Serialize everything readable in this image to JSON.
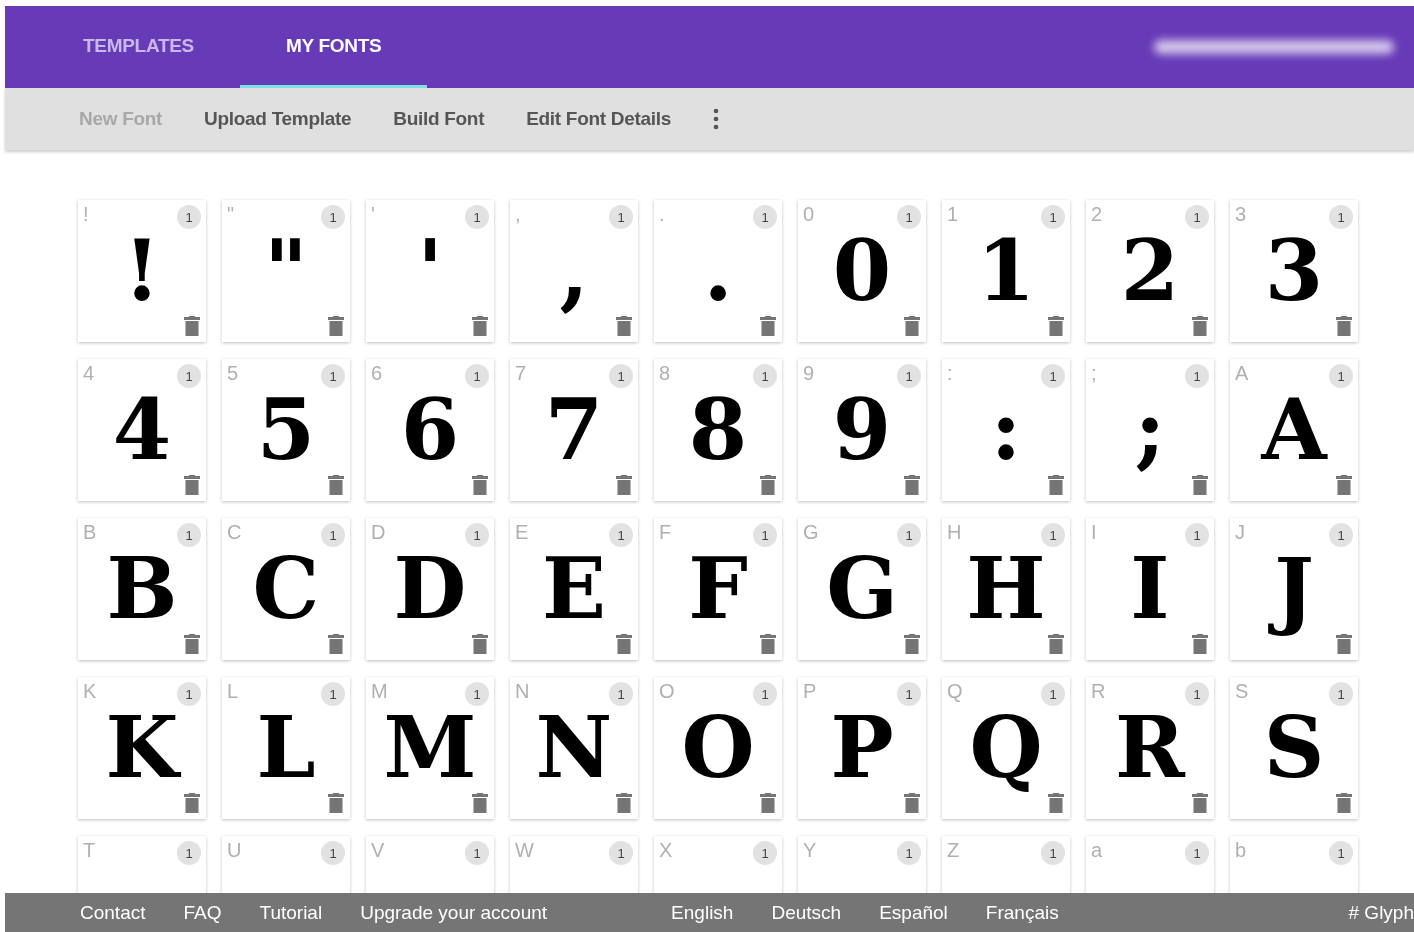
{
  "header": {
    "tabs": [
      {
        "label": "TEMPLATES",
        "selected": false
      },
      {
        "label": "MY FONTS",
        "selected": true
      }
    ]
  },
  "toolbar": {
    "actions": [
      {
        "label": "New Font",
        "disabled": true
      },
      {
        "label": "Upload Template",
        "disabled": false
      },
      {
        "label": "Build Font",
        "disabled": false
      },
      {
        "label": "Edit Font Details",
        "disabled": false
      }
    ]
  },
  "glyphs": [
    {
      "label": "!",
      "count": "1",
      "glyph": "!"
    },
    {
      "label": "\"",
      "count": "1",
      "glyph": "\""
    },
    {
      "label": "'",
      "count": "1",
      "glyph": "'"
    },
    {
      "label": ",",
      "count": "1",
      "glyph": ","
    },
    {
      "label": ".",
      "count": "1",
      "glyph": "."
    },
    {
      "label": "0",
      "count": "1",
      "glyph": "0"
    },
    {
      "label": "1",
      "count": "1",
      "glyph": "1"
    },
    {
      "label": "2",
      "count": "1",
      "glyph": "2"
    },
    {
      "label": "3",
      "count": "1",
      "glyph": "3"
    },
    {
      "label": "4",
      "count": "1",
      "glyph": "4"
    },
    {
      "label": "5",
      "count": "1",
      "glyph": "5"
    },
    {
      "label": "6",
      "count": "1",
      "glyph": "6"
    },
    {
      "label": "7",
      "count": "1",
      "glyph": "7"
    },
    {
      "label": "8",
      "count": "1",
      "glyph": "8"
    },
    {
      "label": "9",
      "count": "1",
      "glyph": "9"
    },
    {
      "label": ":",
      "count": "1",
      "glyph": ":"
    },
    {
      "label": ";",
      "count": "1",
      "glyph": ";"
    },
    {
      "label": "A",
      "count": "1",
      "glyph": "A"
    },
    {
      "label": "B",
      "count": "1",
      "glyph": "B"
    },
    {
      "label": "C",
      "count": "1",
      "glyph": "C"
    },
    {
      "label": "D",
      "count": "1",
      "glyph": "D"
    },
    {
      "label": "E",
      "count": "1",
      "glyph": "E"
    },
    {
      "label": "F",
      "count": "1",
      "glyph": "F"
    },
    {
      "label": "G",
      "count": "1",
      "glyph": "G"
    },
    {
      "label": "H",
      "count": "1",
      "glyph": "H"
    },
    {
      "label": "I",
      "count": "1",
      "glyph": "I"
    },
    {
      "label": "J",
      "count": "1",
      "glyph": "J"
    },
    {
      "label": "K",
      "count": "1",
      "glyph": "K"
    },
    {
      "label": "L",
      "count": "1",
      "glyph": "L"
    },
    {
      "label": "M",
      "count": "1",
      "glyph": "M"
    },
    {
      "label": "N",
      "count": "1",
      "glyph": "N"
    },
    {
      "label": "O",
      "count": "1",
      "glyph": "O"
    },
    {
      "label": "P",
      "count": "1",
      "glyph": "P"
    },
    {
      "label": "Q",
      "count": "1",
      "glyph": "Q"
    },
    {
      "label": "R",
      "count": "1",
      "glyph": "R"
    },
    {
      "label": "S",
      "count": "1",
      "glyph": "S"
    },
    {
      "label": "T",
      "count": "1"
    },
    {
      "label": "U",
      "count": "1"
    },
    {
      "label": "V",
      "count": "1"
    },
    {
      "label": "W",
      "count": "1"
    },
    {
      "label": "X",
      "count": "1"
    },
    {
      "label": "Y",
      "count": "1"
    },
    {
      "label": "Z",
      "count": "1"
    },
    {
      "label": "a",
      "count": "1"
    },
    {
      "label": "b",
      "count": "1"
    }
  ],
  "footer": {
    "links": [
      "Contact",
      "FAQ",
      "Tutorial",
      "Upgrade your account"
    ],
    "languages": [
      "English",
      "Deutsch",
      "Español",
      "Français"
    ],
    "right": "# Glyph"
  }
}
